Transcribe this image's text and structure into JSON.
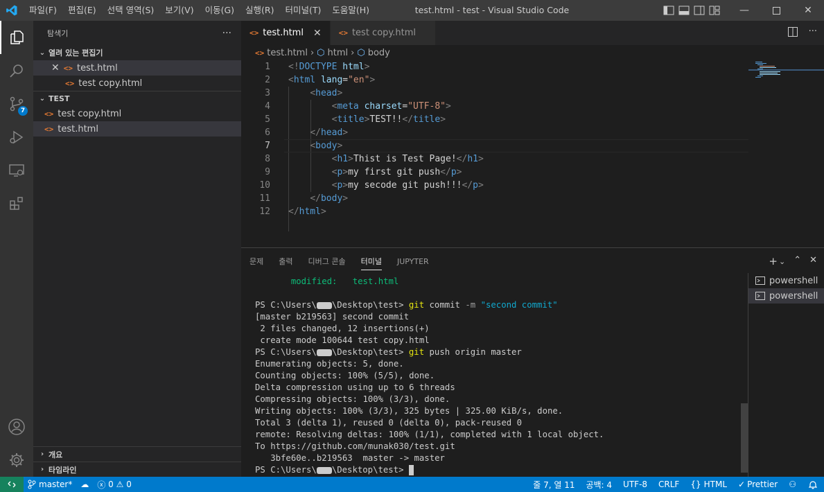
{
  "window": {
    "title": "test.html - test - Visual Studio Code",
    "menus": [
      "파일(F)",
      "편집(E)",
      "선택 영역(S)",
      "보기(V)",
      "이동(G)",
      "실행(R)",
      "터미널(T)",
      "도움말(H)"
    ]
  },
  "activity": {
    "scm_badge": "7"
  },
  "sidebar": {
    "title": "탐색기",
    "more": "···",
    "open_editors": "열려 있는 편집기",
    "open_items": [
      "test.html",
      "test copy.html"
    ],
    "folder": "TEST",
    "files": [
      "test copy.html",
      "test.html"
    ],
    "outline": "개요",
    "timeline": "타임라인"
  },
  "tabs": [
    {
      "label": "test.html"
    },
    {
      "label": "test copy.html"
    }
  ],
  "breadcrumb": [
    "test.html",
    "html",
    "body"
  ],
  "editor": {
    "line_numbers": [
      "1",
      "2",
      "3",
      "4",
      "5",
      "6",
      "7",
      "8",
      "9",
      "10",
      "11",
      "12"
    ]
  },
  "panel": {
    "tabs": [
      "문제",
      "출력",
      "디버그 콘솔",
      "터미널",
      "JUPYTER"
    ],
    "terminals": [
      "powershell",
      "powershell"
    ]
  },
  "terminal": {
    "l1_label": "modified:",
    "l1_file": "test.html",
    "prompt_a": "PS C:\\Users\\",
    "prompt_b": "\\Desktop\\test>",
    "cmd1_git": "git",
    "cmd1_rest": " commit ",
    "cmd1_flag": "-m",
    "cmd1_msg": "\"second commit\"",
    "o1": "[master b219563] second commit",
    "o2": " 2 files changed, 12 insertions(+)",
    "o3": " create mode 100644 test copy.html",
    "cmd2_git": "git",
    "cmd2_rest": " push origin master",
    "o4": "Enumerating objects: 5, done.",
    "o5": "Counting objects: 100% (5/5), done.",
    "o6": "Delta compression using up to 6 threads",
    "o7": "Compressing objects: 100% (3/3), done.",
    "o8": "Writing objects: 100% (3/3), 325 bytes | 325.00 KiB/s, done.",
    "o9": "Total 3 (delta 1), reused 0 (delta 0), pack-reused 0",
    "o10": "remote: Resolving deltas: 100% (1/1), completed with 1 local object.",
    "o11": "To https://github.com/munak030/test.git",
    "o12": "   3bfe60e..b219563  master -> master"
  },
  "status": {
    "branch": "master*",
    "errors": "0",
    "warnings": "0",
    "position": "줄 7, 열 11",
    "spaces": "공백: 4",
    "encoding": "UTF-8",
    "eol": "CRLF",
    "language": "HTML",
    "prettier": "Prettier"
  }
}
